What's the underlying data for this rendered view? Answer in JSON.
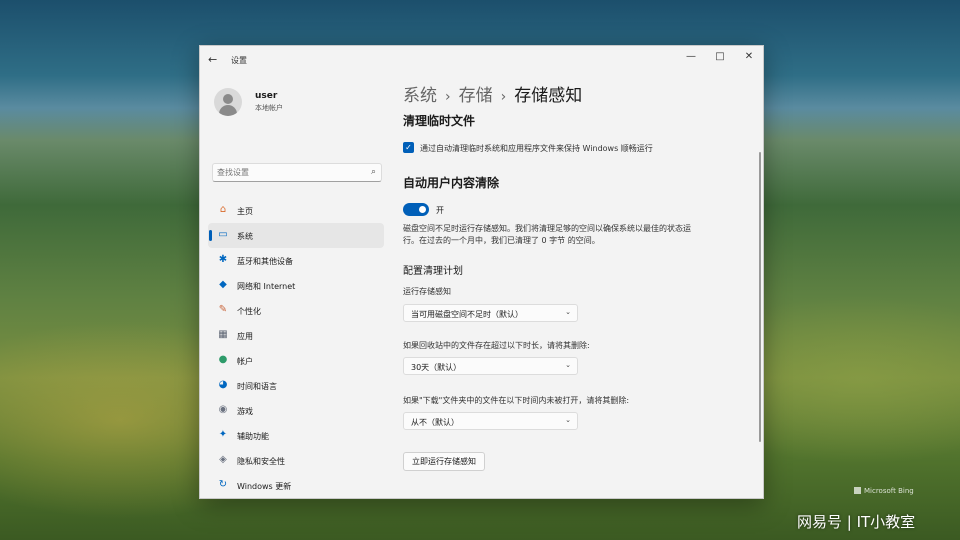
{
  "window": {
    "back_glyph": "←",
    "title": "设置",
    "minimize_glyph": "—",
    "maximize_glyph": "□",
    "close_glyph": "✕"
  },
  "user": {
    "name": "user",
    "account_type": "本地帐户"
  },
  "search": {
    "placeholder": "查找设置",
    "icon": "search-icon"
  },
  "nav": [
    {
      "label": "主页",
      "icon": "home-icon",
      "glyph": "⌂",
      "color": "#d96a2b"
    },
    {
      "label": "系统",
      "icon": "system-monitor-icon",
      "glyph": "▭",
      "color": "#0067c0",
      "selected": true
    },
    {
      "label": "蓝牙和其他设备",
      "icon": "bluetooth-icon",
      "glyph": "✱",
      "color": "#0067c0"
    },
    {
      "label": "网络和 Internet",
      "icon": "wifi-icon",
      "glyph": "◆",
      "color": "#0067c0"
    },
    {
      "label": "个性化",
      "icon": "brush-icon",
      "glyph": "✎",
      "color": "#c8643a"
    },
    {
      "label": "应用",
      "icon": "apps-icon",
      "glyph": "▦",
      "color": "#5a6270"
    },
    {
      "label": "帐户",
      "icon": "account-icon",
      "glyph": "●",
      "color": "#2e9b6a"
    },
    {
      "label": "时间和语言",
      "icon": "globe-clock-icon",
      "glyph": "◕",
      "color": "#0067c0"
    },
    {
      "label": "游戏",
      "icon": "gamepad-icon",
      "glyph": "◉",
      "color": "#6b7280"
    },
    {
      "label": "辅助功能",
      "icon": "accessibility-icon",
      "glyph": "✦",
      "color": "#0067c0"
    },
    {
      "label": "隐私和安全性",
      "icon": "shield-icon",
      "glyph": "◈",
      "color": "#6b7280"
    },
    {
      "label": "Windows 更新",
      "icon": "update-icon",
      "glyph": "↻",
      "color": "#0067c0"
    }
  ],
  "breadcrumb": {
    "part1": "系统",
    "part2": "存储",
    "current": "存储感知",
    "separator": "›"
  },
  "temp_files": {
    "heading": "清理临时文件",
    "checkbox_label": "通过自动清理临时系统和应用程序文件来保持 Windows 顺畅运行",
    "checked": true,
    "check_glyph": "✓"
  },
  "auto_cleanup": {
    "heading": "自动用户内容清除",
    "toggle_state": "开",
    "toggle_on": true,
    "description": "磁盘空间不足时运行存储感知。我们将清理足够的空间以确保系统以最佳的状态运行。在过去的一个月中，我们已清理了 0 字节 的空间。"
  },
  "schedule": {
    "heading": "配置清理计划",
    "run_label": "运行存储感知",
    "run_value": "当可用磁盘空间不足时（默认）",
    "recycle_label": "如果回收站中的文件存在超过以下时长，请将其删除:",
    "recycle_value": "30天（默认）",
    "downloads_label": "如果\"下载\"文件夹中的文件在以下时间内未被打开，请将其删除:",
    "downloads_value": "从不（默认）",
    "chevron_glyph": "⌄",
    "run_now_button": "立即运行存储感知"
  },
  "desktop": {
    "bing_label": "Microsoft Bing",
    "watermark": "网易号 | IT小教室"
  }
}
